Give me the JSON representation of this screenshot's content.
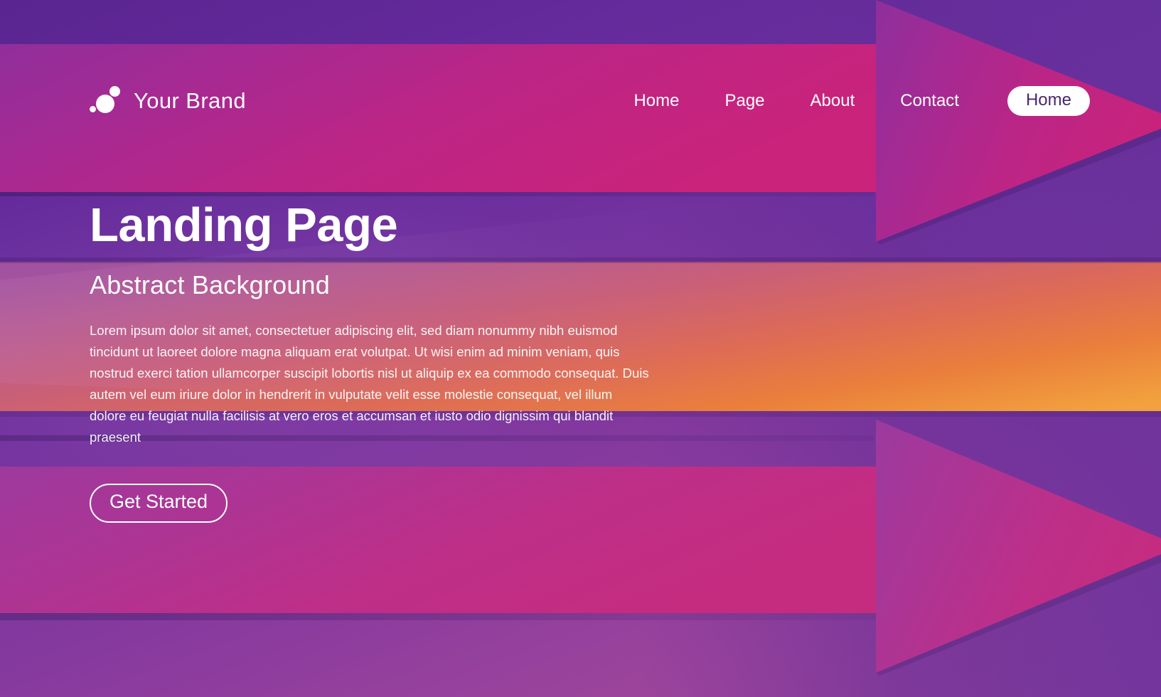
{
  "page": {
    "title": "Landing Page",
    "colors": {
      "bg_top_left": "#5a2590",
      "bg_bottom_left": "#9c449c",
      "arrow_magenta": "#c2257f",
      "arrow_magenta_dark": "#a32a8e",
      "arrow_orange": "#ef8a33",
      "arrow_red": "#d4495a",
      "text_on_light": "#4a2670",
      "white": "#ffffff"
    }
  },
  "header": {
    "brand": {
      "name": "Your Brand",
      "logo_icon": "bubbles-icon"
    },
    "nav": [
      {
        "label": "Home"
      },
      {
        "label": "Page"
      },
      {
        "label": "About"
      },
      {
        "label": "Contact"
      }
    ],
    "cta": {
      "label": "Home"
    }
  },
  "hero": {
    "title": "Landing Page",
    "subtitle": "Abstract Background",
    "paragraph": "Lorem ipsum dolor sit amet, consectetuer adipiscing elit, sed diam nonummy nibh euismod tincidunt ut laoreet dolore magna aliquam erat volutpat. Ut wisi enim ad minim veniam, quis nostrud exerci tation ullamcorper suscipit lobortis nisl ut aliquip ex ea commodo consequat. Duis autem vel eum iriure dolor in hendrerit in vulputate velit esse molestie consequat, vel illum dolore eu feugiat nulla facilisis at vero eros et accumsan et iusto odio dignissim qui blandit praesent",
    "cta": {
      "label": "Get Started"
    }
  },
  "decor": {
    "arrows": [
      {
        "name": "top-arrow",
        "direction": "right",
        "color": "magenta"
      },
      {
        "name": "middle-arrow",
        "direction": "right",
        "color": "orange"
      },
      {
        "name": "bottom-arrow",
        "direction": "right",
        "color": "magenta"
      }
    ]
  }
}
